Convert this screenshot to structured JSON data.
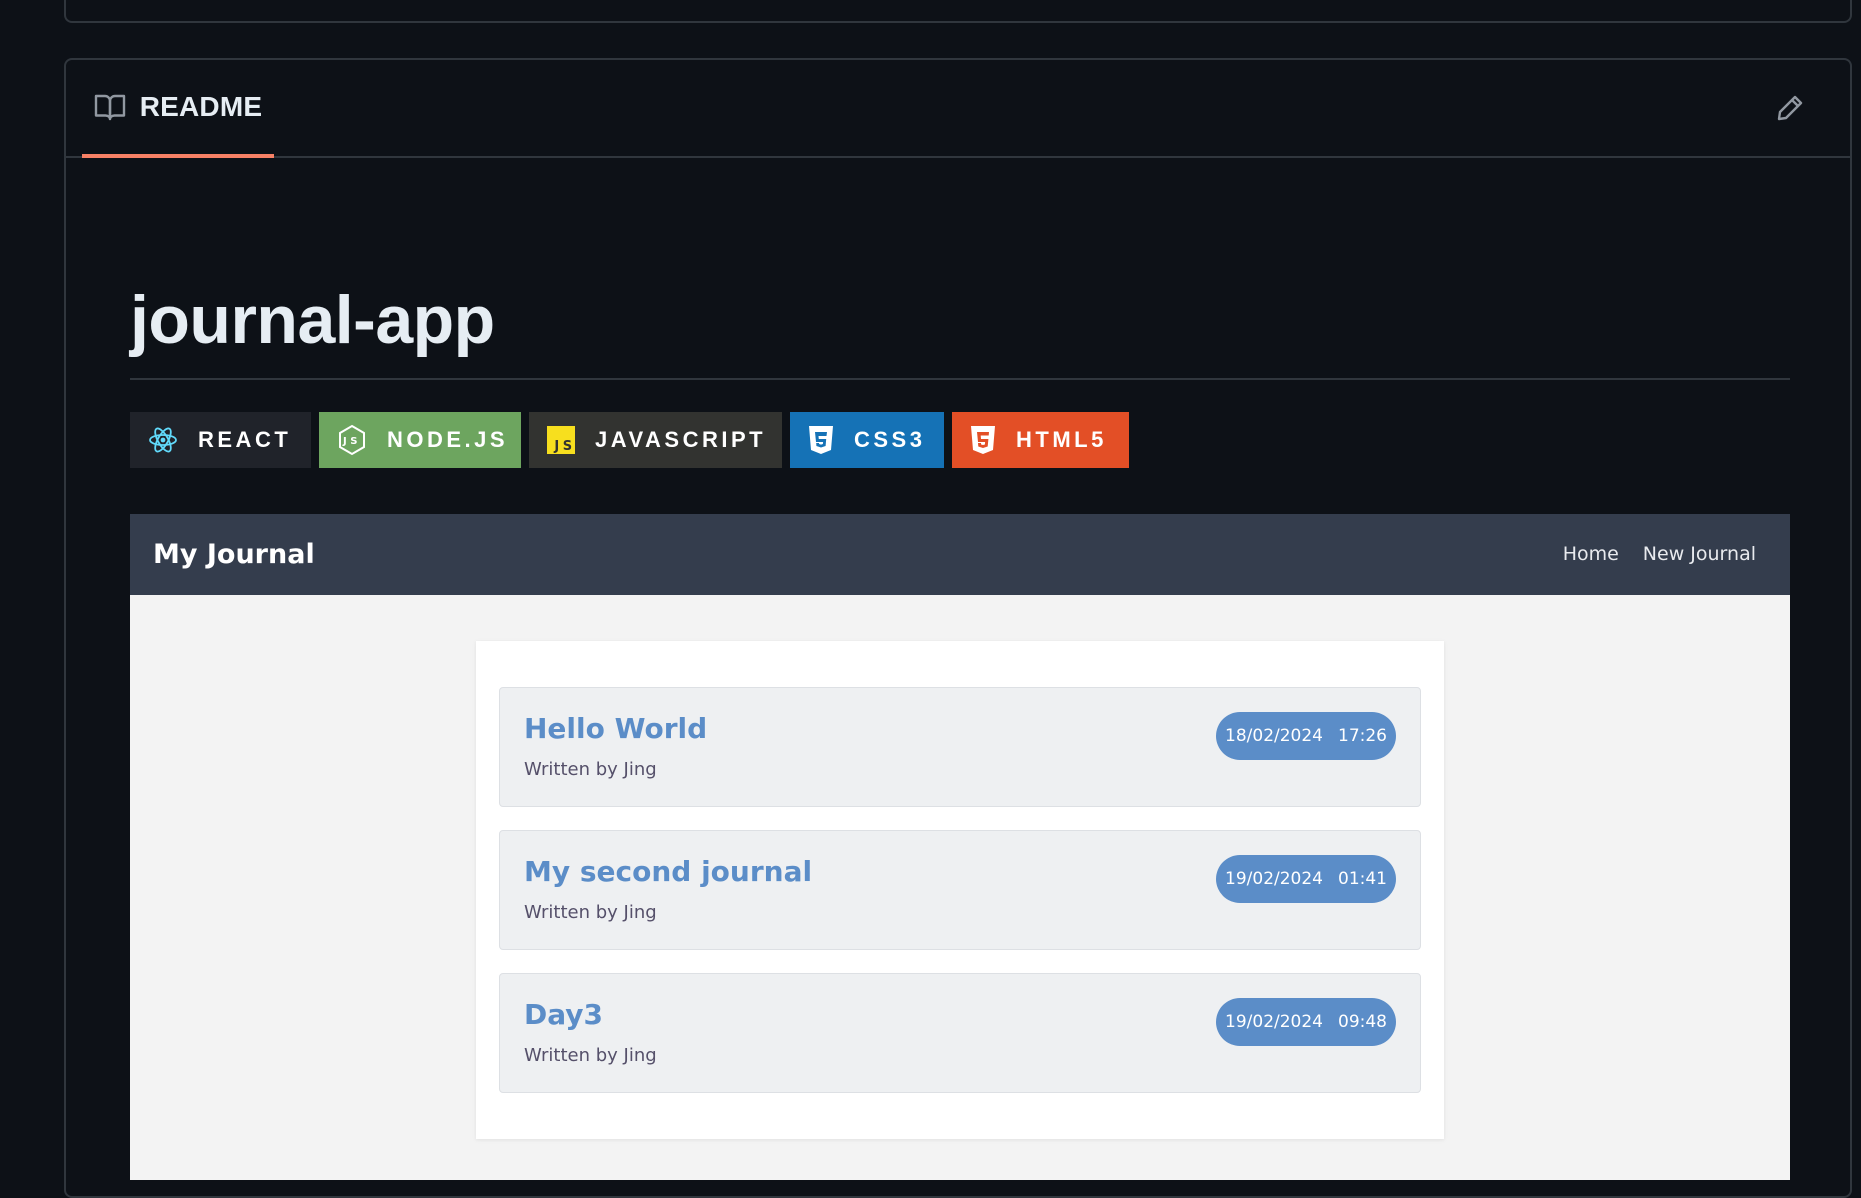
{
  "readme": {
    "tab_label": "README",
    "edit_icon": "pencil-icon",
    "book_icon": "book-icon"
  },
  "repo": {
    "title": "journal-app"
  },
  "badges": [
    {
      "label": "REACT",
      "icon": "react-icon",
      "color": "#20232a"
    },
    {
      "label": "NODE.JS",
      "icon": "nodejs-icon",
      "color": "#6da55f"
    },
    {
      "label": "JAVASCRIPT",
      "icon": "javascript-icon",
      "color": "#323330"
    },
    {
      "label": "CSS3",
      "icon": "css3-icon",
      "color": "#1572b6"
    },
    {
      "label": "HTML5",
      "icon": "html5-icon",
      "color": "#e34f26"
    }
  ],
  "app": {
    "brand": "My Journal",
    "nav": [
      "Home",
      "New Journal"
    ],
    "entries": [
      {
        "title": "Hello World",
        "author": "Written by Jing",
        "date": "18/02/2024",
        "time": "17:26"
      },
      {
        "title": "My second journal",
        "author": "Written by Jing",
        "date": "19/02/2024",
        "time": "01:41"
      },
      {
        "title": "Day3",
        "author": "Written by Jing",
        "date": "19/02/2024",
        "time": "09:48"
      }
    ]
  },
  "colors": {
    "background": "#0d1117",
    "tab_underline": "#f78166",
    "app_nav": "#343d4d",
    "accent": "#5b8dc8"
  }
}
